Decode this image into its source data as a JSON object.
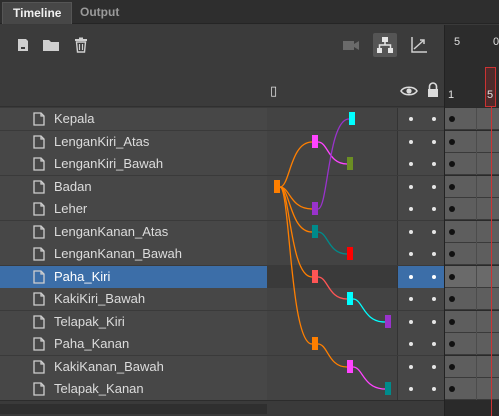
{
  "tabs": [
    {
      "label": "Timeline",
      "active": true
    },
    {
      "label": "Output",
      "active": false
    }
  ],
  "toolbar": {
    "icons": [
      "new-layer-icon",
      "new-folder-icon",
      "delete-icon",
      "camera-icon",
      "layer-parenting-icon",
      "graph-icon"
    ]
  },
  "header": {
    "glyph": "▯",
    "visibility_icon": "eye-icon",
    "lock_icon": "lock-icon"
  },
  "frame_ruler": {
    "top_labels": [
      "5",
      "0"
    ],
    "row_labels": [
      "1",
      "5"
    ]
  },
  "layers": [
    {
      "name": "Kepala",
      "selected": false
    },
    {
      "name": "LenganKiri_Atas",
      "selected": false
    },
    {
      "name": "LenganKiri_Bawah",
      "selected": false
    },
    {
      "name": "Badan",
      "selected": false
    },
    {
      "name": "Leher",
      "selected": false
    },
    {
      "name": "LenganKanan_Atas",
      "selected": false
    },
    {
      "name": "LenganKanan_Bawah",
      "selected": false
    },
    {
      "name": "Paha_Kiri",
      "selected": true
    },
    {
      "name": "KakiKiri_Bawah",
      "selected": false
    },
    {
      "name": "Telapak_Kiri",
      "selected": false
    },
    {
      "name": "Paha_Kanan",
      "selected": false
    },
    {
      "name": "KakiKanan_Bawah",
      "selected": false
    },
    {
      "name": "Telapak_Kanan",
      "selected": false
    }
  ],
  "colors": {
    "selection": "#3c6ea8",
    "playhead": "#cc3333",
    "parent_nodes": [
      "#00ffff",
      "#ff44ff",
      "#6b8e23",
      "#ff7f00",
      "#9933cc",
      "#008b8b",
      "#ff0000",
      "#ff5555",
      "#00ffff",
      "#9933cc",
      "#ff7f00",
      "#ff44ff",
      "#008b8b"
    ]
  }
}
